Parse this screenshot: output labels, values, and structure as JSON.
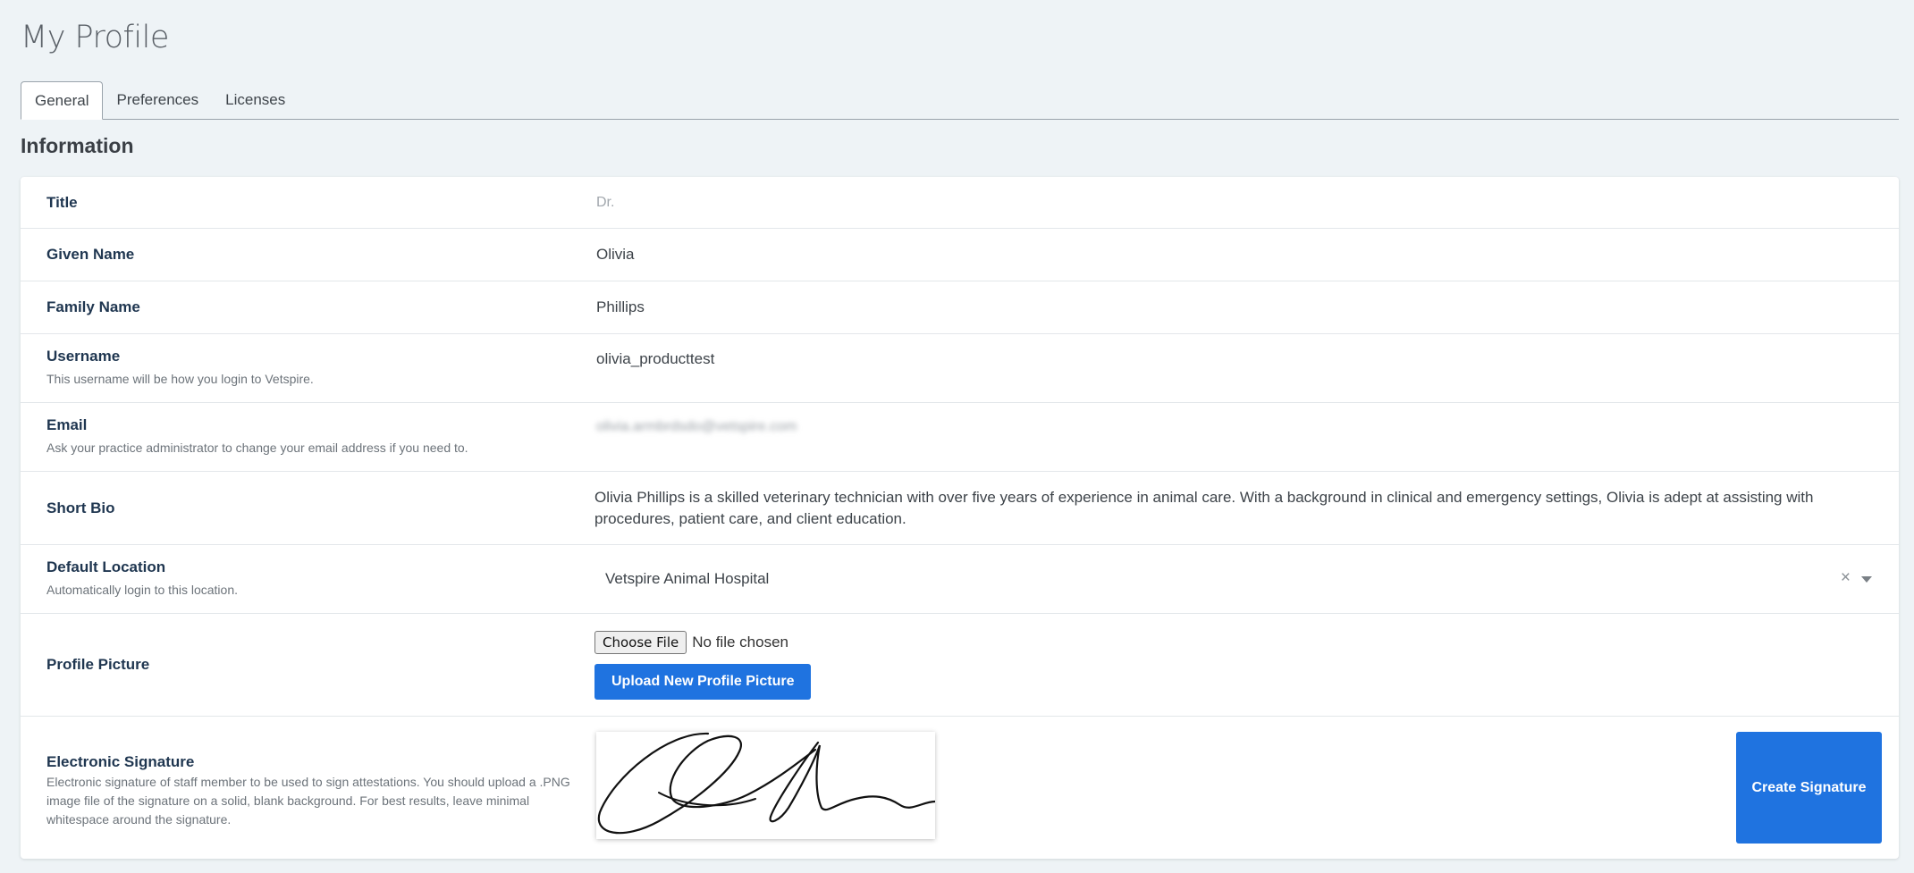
{
  "page": {
    "title": "My Profile"
  },
  "tabs": [
    {
      "label": "General",
      "active": true
    },
    {
      "label": "Preferences",
      "active": false
    },
    {
      "label": "Licenses",
      "active": false
    }
  ],
  "section": {
    "title": "Information"
  },
  "fields": {
    "title": {
      "label": "Title",
      "placeholder": "Dr."
    },
    "given_name": {
      "label": "Given Name",
      "value": "Olivia"
    },
    "family_name": {
      "label": "Family Name",
      "value": "Phillips"
    },
    "username": {
      "label": "Username",
      "hint": "This username will be how you login to Vetspire.",
      "value": "olivia_producttest"
    },
    "email": {
      "label": "Email",
      "hint": "Ask your practice administrator to change your email address if you need to.",
      "value": "olivia.armbrdsdo@vetspire.com"
    },
    "short_bio": {
      "label": "Short Bio",
      "value": "Olivia Phillips is a skilled veterinary technician with over five years of experience in animal care. With a background in clinical and emergency settings, Olivia is adept at assisting with procedures, patient care, and client education."
    },
    "default_location": {
      "label": "Default Location",
      "hint": "Automatically login to this location.",
      "value": "Vetspire Animal Hospital",
      "clear_glyph": "×"
    },
    "profile_picture": {
      "label": "Profile Picture",
      "choose_file_label": "Choose File",
      "no_file_text": "No file chosen",
      "upload_button": "Upload New Profile Picture"
    },
    "electronic_signature": {
      "label": "Electronic Signature",
      "hint": "Electronic signature of staff member to be used to sign attestations. You should upload a .PNG image file of the signature on a solid, blank background. For best results, leave minimal whitespace around the signature.",
      "create_button": "Create Signature"
    }
  },
  "colors": {
    "background": "#eef3f6",
    "primary": "#1f73e0",
    "label": "#1f3650"
  }
}
